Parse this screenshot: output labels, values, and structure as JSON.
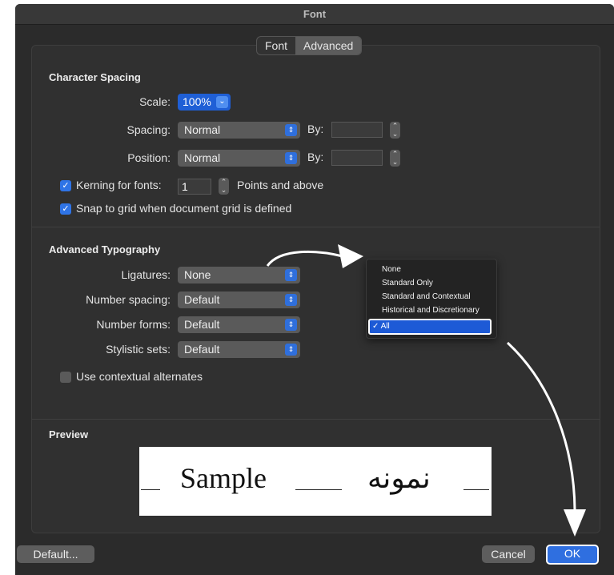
{
  "window": {
    "title": "Font"
  },
  "tabs": [
    {
      "label": "Font",
      "selected": false
    },
    {
      "label": "Advanced",
      "selected": true
    }
  ],
  "character_spacing": {
    "title": "Character Spacing",
    "scale_label": "Scale:",
    "scale_value": "100%",
    "spacing_label": "Spacing:",
    "spacing_value": "Normal",
    "spacing_by_label": "By:",
    "spacing_by_value": "",
    "position_label": "Position:",
    "position_value": "Normal",
    "position_by_label": "By:",
    "position_by_value": "",
    "kerning_label": "Kerning for fonts:",
    "kerning_checked": true,
    "kerning_value": "1",
    "kerning_suffix": "Points and above",
    "snap_label": "Snap to grid when document grid is defined",
    "snap_checked": true
  },
  "advanced_typography": {
    "title": "Advanced Typography",
    "ligatures_label": "Ligatures:",
    "ligatures_value": "None",
    "number_spacing_label": "Number spacing:",
    "number_spacing_value": "Default",
    "number_forms_label": "Number forms:",
    "number_forms_value": "Default",
    "stylistic_sets_label": "Stylistic sets:",
    "stylistic_sets_value": "Default",
    "contextual_label": "Use contextual alternates",
    "contextual_checked": false
  },
  "ligatures_menu": {
    "options": [
      "None",
      "Standard Only",
      "Standard and Contextual",
      "Historical and Discretionary"
    ],
    "selected": "✓ All"
  },
  "preview": {
    "title": "Preview",
    "sample_latin": "Sample",
    "sample_arabic": "نمونه"
  },
  "buttons": {
    "default": "Default...",
    "cancel": "Cancel",
    "ok": "OK"
  },
  "colors": {
    "accent": "#2f6fe0",
    "window_bg": "#2b2b2b",
    "annotation": "#ffffff"
  },
  "icons": {
    "popup_arrow": "chevrons-updown-icon",
    "check": "checkmark-icon",
    "annotation_arrow": "curved-arrow-icon"
  }
}
